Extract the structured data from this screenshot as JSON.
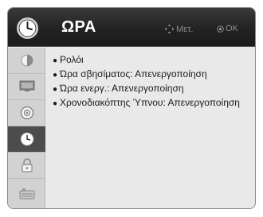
{
  "header": {
    "title": "ΩΡΑ",
    "hint_move": "Μετ.",
    "hint_ok": "OK",
    "icon": "clock-icon"
  },
  "sidebar": {
    "items": [
      {
        "name": "picture",
        "icon": "picture-icon",
        "active": false
      },
      {
        "name": "screen",
        "icon": "monitor-icon",
        "active": false
      },
      {
        "name": "audio",
        "icon": "speaker-icon",
        "active": false
      },
      {
        "name": "time",
        "icon": "clock-icon",
        "active": true
      },
      {
        "name": "lock",
        "icon": "lock-icon",
        "active": false
      },
      {
        "name": "options",
        "icon": "options-icon",
        "active": false
      }
    ]
  },
  "menu": {
    "items": [
      {
        "label": "Ρολόι"
      },
      {
        "label": "Ώρα σβησίματος: Απενεργοποίηση"
      },
      {
        "label": "Ώρα ενεργ.: Απενεργοποίηση"
      },
      {
        "label": "Χρονοδιακόπτης Ύπνου: Απενεργοποίηση"
      }
    ]
  },
  "colors": {
    "header_bg": "#222222",
    "panel_bg": "#e9e9e9",
    "sidebar_bg": "#d2d2d2",
    "active_item_bg": "#4c4c4c"
  }
}
